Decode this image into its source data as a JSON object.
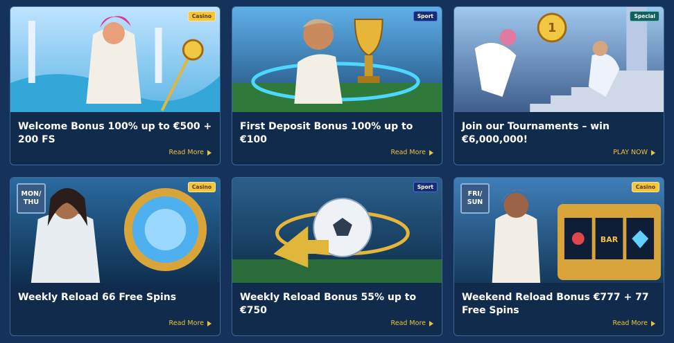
{
  "promotions": [
    {
      "badge": "Casino",
      "title": "Welcome Bonus 100% up to €500 + 200 FS",
      "cta": "Read More"
    },
    {
      "badge": "Sport",
      "title": "First Deposit Bonus 100% up to €100",
      "cta": "Read More"
    },
    {
      "badge": "Special",
      "title": "Join our Tournaments – win €6,000,000!",
      "cta": "PLAY NOW"
    },
    {
      "badge": "Casino",
      "day_tag": [
        "MON/",
        "THU"
      ],
      "title": "Weekly Reload 66 Free Spins",
      "cta": "Read More"
    },
    {
      "badge": "Sport",
      "title": "Weekly Reload Bonus 55% up to €750",
      "cta": "Read More"
    },
    {
      "badge": "Casino",
      "day_tag": [
        "FRI/",
        "SUN"
      ],
      "title": "Weekend Reload Bonus €777 + 77 Free Spins",
      "cta": "Read More"
    }
  ],
  "colors": {
    "accent": "#f0c23a",
    "card_bg": "#112b4c",
    "page_bg": "#14325a"
  },
  "icons": [
    "play-arrow-icon"
  ]
}
